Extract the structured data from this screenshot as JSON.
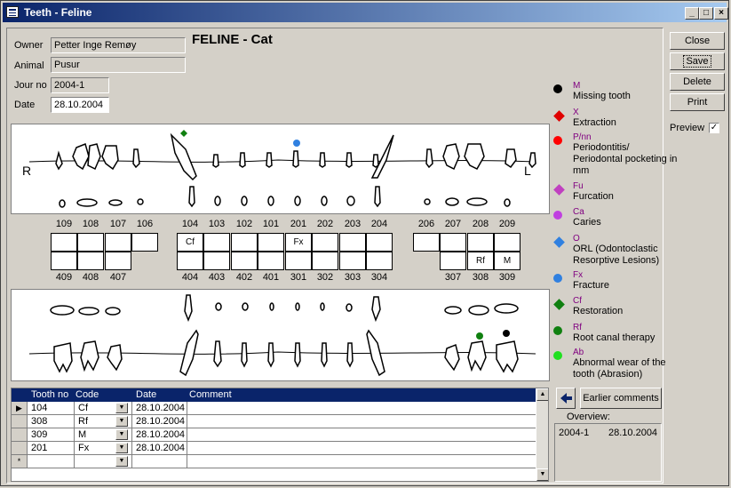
{
  "window": {
    "title": "Teeth - Feline",
    "minimize": "_",
    "maximize": "□",
    "close": "×"
  },
  "form": {
    "owner_label": "Owner",
    "owner_value": "Petter Inge Remøy",
    "animal_label": "Animal",
    "animal_value": "Pusur",
    "journo_label": "Jour no",
    "journo_value": "2004-1",
    "date_label": "Date",
    "date_value": "28.10.2004",
    "species": "FELINE - Cat"
  },
  "upper_chart": {
    "right_label": "R",
    "left_label": "L"
  },
  "upper_numbers": [
    "109",
    "108",
    "107",
    "106",
    "104",
    "103",
    "102",
    "101",
    "201",
    "202",
    "203",
    "204",
    "206",
    "207",
    "208",
    "209"
  ],
  "upper_boxes": [
    "",
    "",
    "",
    "",
    "Cf",
    "",
    "",
    "",
    "Fx",
    "",
    "",
    "",
    "",
    "",
    "",
    ""
  ],
  "lower_boxes": [
    "",
    "",
    "",
    "",
    "",
    "",
    "",
    "",
    "",
    "",
    "",
    "",
    "",
    "",
    "Rf",
    "M"
  ],
  "lower_numbers": [
    "409",
    "408",
    "407",
    "404",
    "403",
    "402",
    "401",
    "301",
    "302",
    "303",
    "304",
    "307",
    "308",
    "309"
  ],
  "buttons": {
    "close": "Close",
    "save": "Save",
    "delete": "Delete",
    "print": "Print"
  },
  "preview": {
    "label": "Preview",
    "checked": "✓"
  },
  "legend": [
    {
      "code": "M",
      "desc": "Missing tooth",
      "color": "#000000",
      "shape": "circle"
    },
    {
      "code": "X",
      "desc": "Extraction",
      "color": "#e00000",
      "shape": "diamond"
    },
    {
      "code": "P/nn",
      "desc": "Periodontitis/ Periodontal pocketing in mm",
      "color": "#ff0000",
      "shape": "circle"
    },
    {
      "code": "Fu",
      "desc": "Furcation",
      "color": "#c040c0",
      "shape": "diamond"
    },
    {
      "code": "Ca",
      "desc": "Caries",
      "color": "#c040e0",
      "shape": "circle"
    },
    {
      "code": "O",
      "desc": "ORL (Odontoclastic Resorptive Lesions)",
      "color": "#3080e0",
      "shape": "diamond"
    },
    {
      "code": "Fx",
      "desc": "Fracture",
      "color": "#3080e0",
      "shape": "circle"
    },
    {
      "code": "Cf",
      "desc": "Restoration",
      "color": "#108010",
      "shape": "diamond"
    },
    {
      "code": "Rf",
      "desc": "Root canal therapy",
      "color": "#108010",
      "shape": "circle"
    },
    {
      "code": "Ab",
      "desc": "Abnormal wear of the tooth (Abrasion)",
      "color": "#20e020",
      "shape": "circle"
    }
  ],
  "grid": {
    "headers": [
      "Tooth no",
      "Code",
      "Date",
      "Comment"
    ],
    "rows": [
      {
        "tooth": "104",
        "code": "Cf",
        "date": "28.10.2004",
        "comment": ""
      },
      {
        "tooth": "308",
        "code": "Rf",
        "date": "28.10.2004",
        "comment": ""
      },
      {
        "tooth": "309",
        "code": "M",
        "date": "28.10.2004",
        "comment": ""
      },
      {
        "tooth": "201",
        "code": "Fx",
        "date": "28.10.2004",
        "comment": ""
      }
    ],
    "new_row_marker": "*",
    "current_row_marker": "▶"
  },
  "earlier_comments": "Earlier comments",
  "overview": {
    "label": "Overview:",
    "journo": "2004-1",
    "date": "28.10.2004"
  }
}
